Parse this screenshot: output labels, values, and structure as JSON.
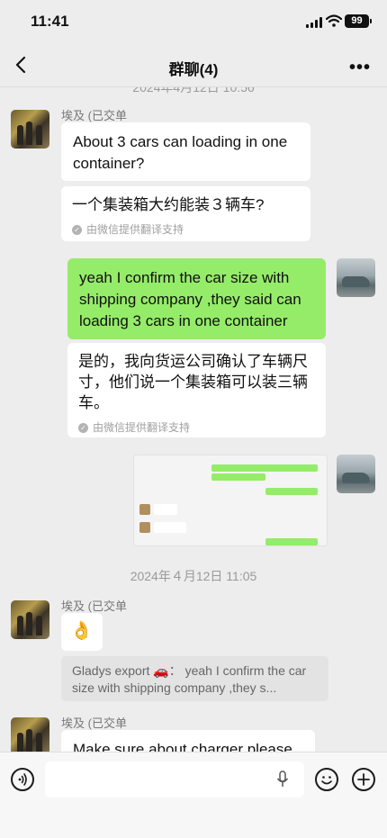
{
  "status": {
    "time": "11:41",
    "battery": "99"
  },
  "header": {
    "title": "群聊(4)"
  },
  "messages": {
    "top_timestamp": "2024年4月12日 10:56",
    "m1": {
      "sender": "埃及 (已交单",
      "text": "About 3 cars can loading in one container?",
      "translation": "一个集装箱大约能装３辆车?",
      "translation_note": "由微信提供翻译支持"
    },
    "m2": {
      "text": "yeah I confirm the car size with shipping company ,they said can loading 3 cars in one container",
      "translation": "是的，我向货运公司确认了车辆尺寸，他们说一个集装箱可以装三辆车。",
      "translation_note": "由微信提供翻译支持"
    },
    "timestamp2": "2024年４月12日 11:05",
    "m4": {
      "sender": "埃及 (已交单",
      "emoji": "👌",
      "quote": "Gladys export 🚗： yeah I confirm the car size with shipping company ,they s..."
    },
    "m5": {
      "sender": "埃及 (已交单",
      "text": "Make sure about charger please"
    }
  }
}
